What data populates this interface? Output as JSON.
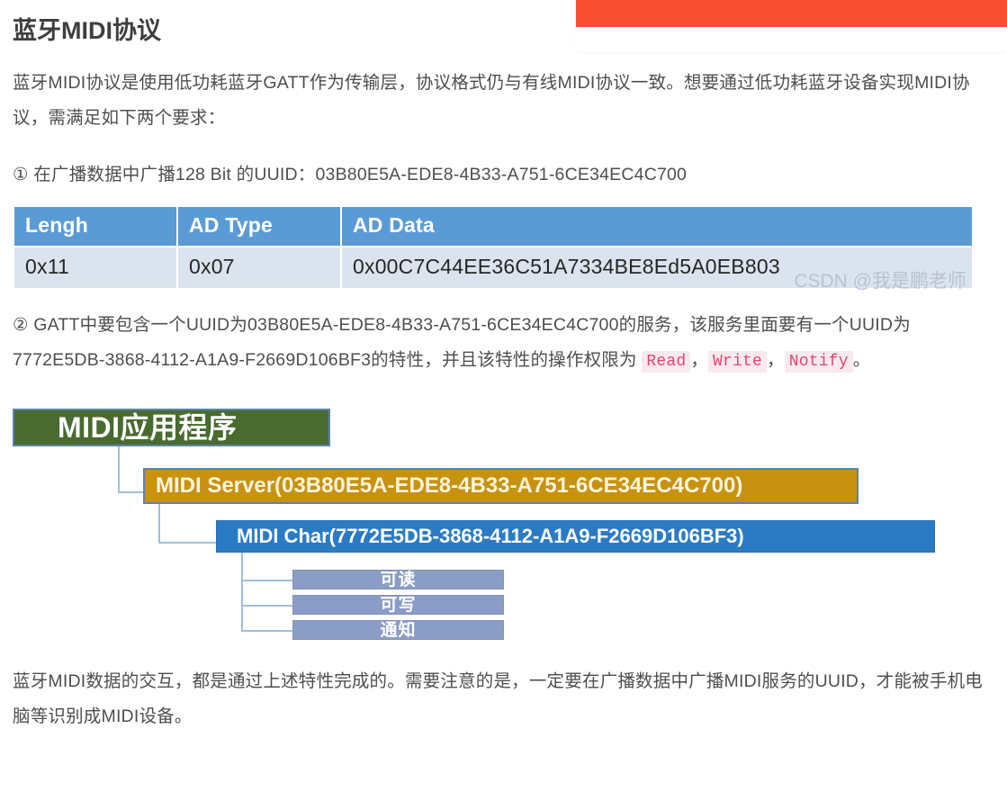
{
  "top_panel": {
    "accent_color": "#fb4f33"
  },
  "article": {
    "title": "蓝牙MIDI协议",
    "intro": "蓝牙MIDI协议是使用低功耗蓝牙GATT作为传输层，协议格式仍与有线MIDI协议一致。想要通过低功耗蓝牙设备实现MIDI协议，需满足如下两个要求：",
    "requirement_1": "① 在广播数据中广播128 Bit 的UUID：03B80E5A-EDE8-4B33-A751-6CE34EC4C700",
    "requirement_2_part1": "② GATT中要包含一个UUID为03B80E5A-EDE8-4B33-A751-6CE34EC4C700的服务，该服务里面要有一个UUID为7772E5DB-3868-4112-A1A9-F2669D106BF3的特性，并且该特性的操作权限为 ",
    "code_read": "Read",
    "code_write": "Write",
    "code_notify": "Notify",
    "sep_comma_1": "，",
    "sep_comma_2": "，",
    "sep_period": "。",
    "outro": "蓝牙MIDI数据的交互，都是通过上述特性完成的。需要注意的是，一定要在广播数据中广播MIDI服务的UUID，才能被手机电脑等识别成MIDI设备。"
  },
  "ad_table": {
    "headers": [
      "Lengh",
      "AD Type",
      "AD Data"
    ],
    "rows": [
      [
        "0x11",
        "0x07",
        "0x00C7C44EE36C51A7334BE8Ed5A0EB803"
      ]
    ],
    "header_bg": "#5b9bd5",
    "row_bg": "#dbe3ee"
  },
  "watermark": {
    "text": "CSDN @我是鹏老师"
  },
  "diagram": {
    "app_box": "MIDI应用程序",
    "server_box": "MIDI Server(03B80E5A-EDE8-4B33-A751-6CE34EC4C700)",
    "char_box": "MIDI Char(7772E5DB-3868-4112-A1A9-F2669D106BF3)",
    "leaves": [
      "可读",
      "可写",
      "通知"
    ],
    "colors": {
      "app": "#4a6b2f",
      "server": "#c89211",
      "char": "#2b7bc4",
      "leaf": "#8a9dc6",
      "connector": "#9cc0e0"
    }
  }
}
